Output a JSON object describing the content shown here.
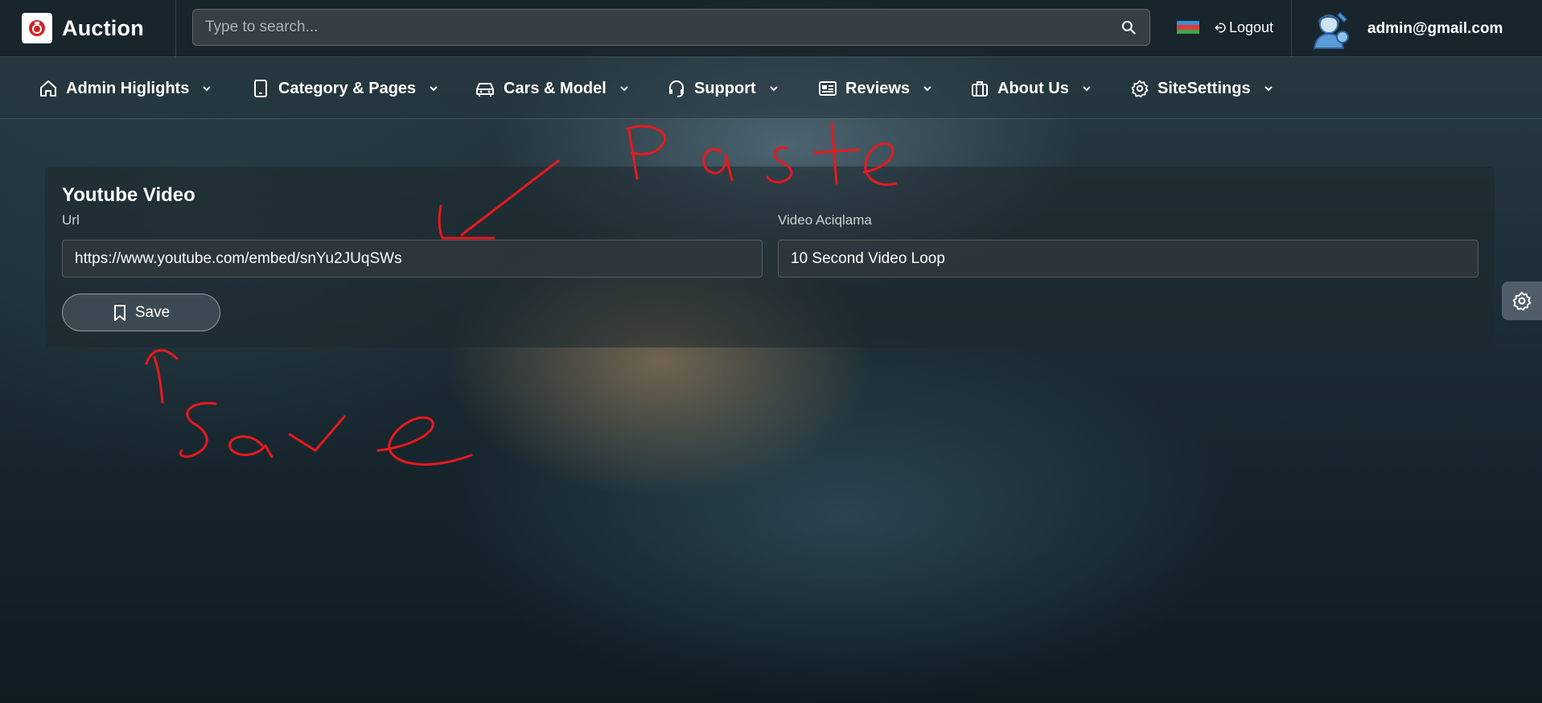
{
  "header": {
    "brand": "Auction",
    "search_placeholder": "Type to search...",
    "logout_label": "Logout",
    "user_email": "admin@gmail.com",
    "icons": {
      "search": "search-icon",
      "logout": "logout-icon",
      "flag": "azerbaijan-flag-icon",
      "avatar": "admin-avatar-icon"
    }
  },
  "nav": {
    "items": [
      {
        "label": "Admin Higlights",
        "icon": "home-icon"
      },
      {
        "label": "Category & Pages",
        "icon": "tablet-icon"
      },
      {
        "label": "Cars & Model",
        "icon": "car-icon"
      },
      {
        "label": "Support",
        "icon": "headset-icon"
      },
      {
        "label": "Reviews",
        "icon": "newspaper-icon"
      },
      {
        "label": "About Us",
        "icon": "briefcase-icon"
      },
      {
        "label": "SiteSettings",
        "icon": "gear-icon"
      }
    ]
  },
  "card": {
    "title": "Youtube Video",
    "url_label": "Url",
    "url_value": "https://www.youtube.com/embed/snYu2JUqSWs",
    "desc_label": "Video Aciqlama",
    "desc_value": "10 Second Video Loop",
    "save_label": "Save"
  },
  "colors": {
    "annotation": "#e8191e",
    "brand_logo": "#d62027"
  }
}
